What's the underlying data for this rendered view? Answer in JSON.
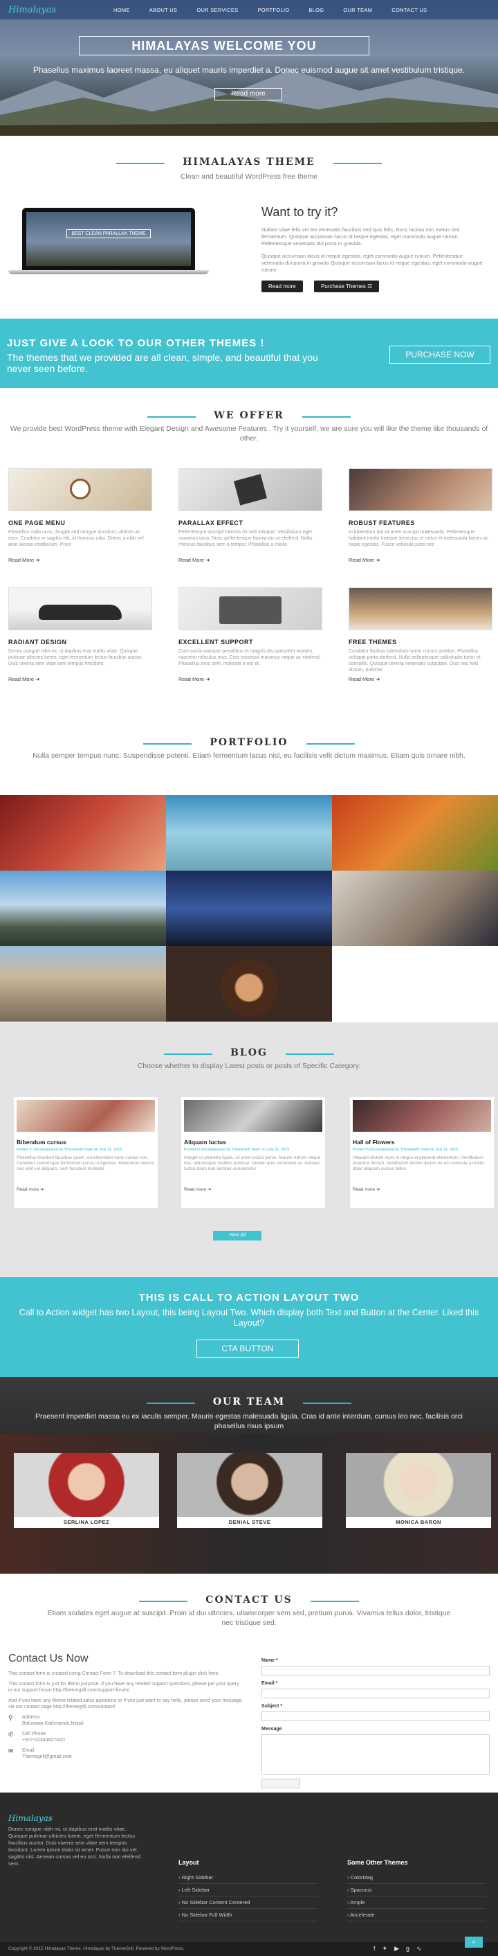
{
  "header": {
    "logo": "Himalayas",
    "nav": [
      "HOME",
      "ABOUT US",
      "OUR SERVICES",
      "PORTFOLIO",
      "BLOG",
      "OUR TEAM",
      "CONTACT US"
    ],
    "hero_title": "HIMALAYAS WELCOME YOU",
    "hero_text": "Phasellus maximus laoreet massa, eu aliquet mauris imperdiet a. Donec euismod augue sit amet vestibulum tristique.",
    "hero_button": "Read more"
  },
  "theme": {
    "title": "HIMALAYAS THEME",
    "subtitle": "Clean and beautiful WordPress free theme",
    "laptop_caption": "BEST CLEAN PARALLAX THEME",
    "try_title": "Want to try it?",
    "p1": "Nullam vitae felis vel leo venenatis faucibus sed quis felis. Nunc lacinia non metus sed fermentum. Quisque accumsan lacus id neque egestas, eget commodo augue rutrum. Pellentesque venenatis dui porta in gravida.",
    "p2": "Quisque accumsan lacus id neque egestas, eget commodo augue rutrum. Pellentesque venenatis dui porta in gravida Quisque accumsan lacus id neque egestas, eget commodo augue rutrum",
    "btn_read": "Read more",
    "btn_purchase": "Purchase Themes"
  },
  "promo": {
    "title": "JUST GIVE A LOOK TO OUR OTHER THEMES !",
    "text": "The themes that we provided are all clean, simple, and beautiful that you never seen before.",
    "button": "PURCHASE NOW"
  },
  "offer": {
    "title": "WE OFFER",
    "subtitle": "We provide best WordPress theme with Elegant Design and Awesome Features . Try it yourself, we are sure you will like the theme like thousands of other.",
    "items": [
      {
        "title": "ONE PAGE MENU",
        "text": "Phasellus nulla nunc, feugiat sed congue tincidunt, ultrices ac eros. Curabitur in sagittis elit, id rhoncus odio. Donec a nibh vel ante lacinia vestibulum. Proin",
        "more": "Read More"
      },
      {
        "title": "PARALLAX EFFECT",
        "text": "Pellentesque suscipit lobortis mi sed volutpat. Vestibulum eget maximus urna. Nunc pellentesque lacinia dui ut eleifend. Nulla rhoncus faucibus sem a tempor. Phasellus a mollis",
        "more": "Read More"
      },
      {
        "title": "ROBUST FEATURES",
        "text": "In bibendum dui sit amet suscipit malesuada. Pellentesque habitant morbi tristique senectus et netus et malesuada fames ac turpis egestas. Fusce vehicula justo nec",
        "more": "Read More"
      },
      {
        "title": "RADIANT DESIGN",
        "text": "Donec congue nibh mi, ut dapibus erat mattis vitae. Quisque pulvinar ultricies lorem, eget fermentum lectus faucibus auctor. Duis viverra sem vitae sem tempus tincidunt.",
        "more": "Read More"
      },
      {
        "title": "EXCELLENT SUPPORT",
        "text": "Cum sociis natoque penatibus et magnis dis parturient montes, nascetur ridiculus mus. Cras euismod maximus neque ac eleifend. Phasellus eros sem, molestie a est et.",
        "more": "Read More"
      },
      {
        "title": "FREE THEMES",
        "text": "Curabitur facilisis bibendum lorem cursus porttitor. Phasellus volutpat porta eleifend. Nulla pellentesque sollicitudin tortor et convallis. Quisque viverra venenatis vulputate. Duis nec felis dictum, pulvinar",
        "more": "Read More"
      }
    ]
  },
  "portfolio": {
    "title": "PORTFOLIO",
    "subtitle": "Nulla semper tempus nunc. Suspendisse potenti. Etiam fermentum lacus nisl, eu facilisis velit dictum maximus. Etiam quis ornare nibh."
  },
  "blog": {
    "title": "BLOG",
    "subtitle": "Choose whether to display Latest posts or posts of Specific Category.",
    "posts": [
      {
        "title": "Bibendum cursus",
        "meta": "Posted in Uncategorized by ThemeGrill Team on July 31, 2015",
        "text": "Phasellus tincidunt faucibus quam, eu bibendum nunc cursus non. Curabitur scelerisque fermentum purus in egestas. Maecenas viverra nec velit vel aliquam, nam tincidunt molestie",
        "more": "Read more"
      },
      {
        "title": "Aliquam luctus",
        "meta": "Posted in Uncategorized by ThemeGrill Team on July 31, 2015",
        "text": "Integer ut pharetra ligula, sit amet luctus purus. Mauris rutrum neque nisi, ullamcorper facilisis pulvinar. Nullam quis commodo ex. Aenean luctus diam non semper consectetur",
        "more": "Read more"
      },
      {
        "title": "Hall of Flowers",
        "meta": "Posted in Uncategorized by ThemeGrill Team on July 31, 2015",
        "text": "Aliquam dictum nunc in neque at placerat elementum. Vestibulum pharetra dictum. Vestibulum dictum ipsum eu est vehicula a mollis dolor aliquam cursus tellus",
        "more": "Read more"
      }
    ],
    "view_all": "View All"
  },
  "cta": {
    "title": "THIS IS CALL TO ACTION LAYOUT TWO",
    "text": "Call to Action widget has two Layout, this being Layout Two. Which display both Text and Button at the Center. Liked this Layout?",
    "button": "CTA BUTTON"
  },
  "team": {
    "title": "OUR TEAM",
    "subtitle": "Praesent imperdiet massa eu ex iaculis semper. Mauris egestas malesuada ligula. Cras id ante interdum, cursus leo nec, facilisis orci phasellus risus ipsum",
    "members": [
      "SERLINA LOPEZ",
      "DENIAL STEVE",
      "MONICA BARON"
    ]
  },
  "contact": {
    "title": "CONTACT US",
    "subtitle": "Etiam sodales eget augue at suscipit. Proin id dui ultricies, ullamcorper sem sed, pretium purus. Vivamus tellus dolor, tristique nec tristique sed.",
    "left_title": "Contact Us Now",
    "p1": "This contact form is created using Contact Form 7. To download this contact form plugin click here.",
    "p2": "This contact form is just for demo purpose. If you have any related support questions, please put your query in our support forum http://themegrill.com/support-forum/",
    "p3": "And if you have any theme related sales questions or if you just want to say hello, please send your message via our contact page http://themegrill.com/contact/",
    "address_label": "Address",
    "address": "Baluwatar,Kathmandu,Nepal",
    "phone_label": "Cell Phone",
    "phone": "+977-0234482742D",
    "email_label": "Email",
    "email": "Themegrill@gmail.com",
    "form": {
      "name": "Name *",
      "email": "Email *",
      "subject": "Subject *",
      "message": "Message"
    }
  },
  "footer": {
    "logo": "Himalayas",
    "about": "Donec congue nibh mi, ut dapibus erat mattis vitae. Quisque pulvinar ultricies lorem, eget fermentum lectus faucibus auctor. Duis viverra sem vitae sem tempus tincidunt. Lorem ipsum dolor sit amet. Fusce non dui vel, sagittis nisl. Aenean cursus vel eu orci. Nulla non eleifend sem.",
    "col2_title": "Layout",
    "col2": [
      "Right Sidebar",
      "Left Sidebar",
      "No Sidebar Content Centered",
      "No Sidebar Full Width"
    ],
    "col3_title": "Some Other Themes",
    "col3": [
      "ColorMag",
      "Spacious",
      "Ample",
      "Accelerate"
    ],
    "copyright": "Copyright © 2015 Himalayas Theme. Himalayas by ThemeGrill. Powered by WordPress.",
    "accent": "#43c2cf"
  }
}
